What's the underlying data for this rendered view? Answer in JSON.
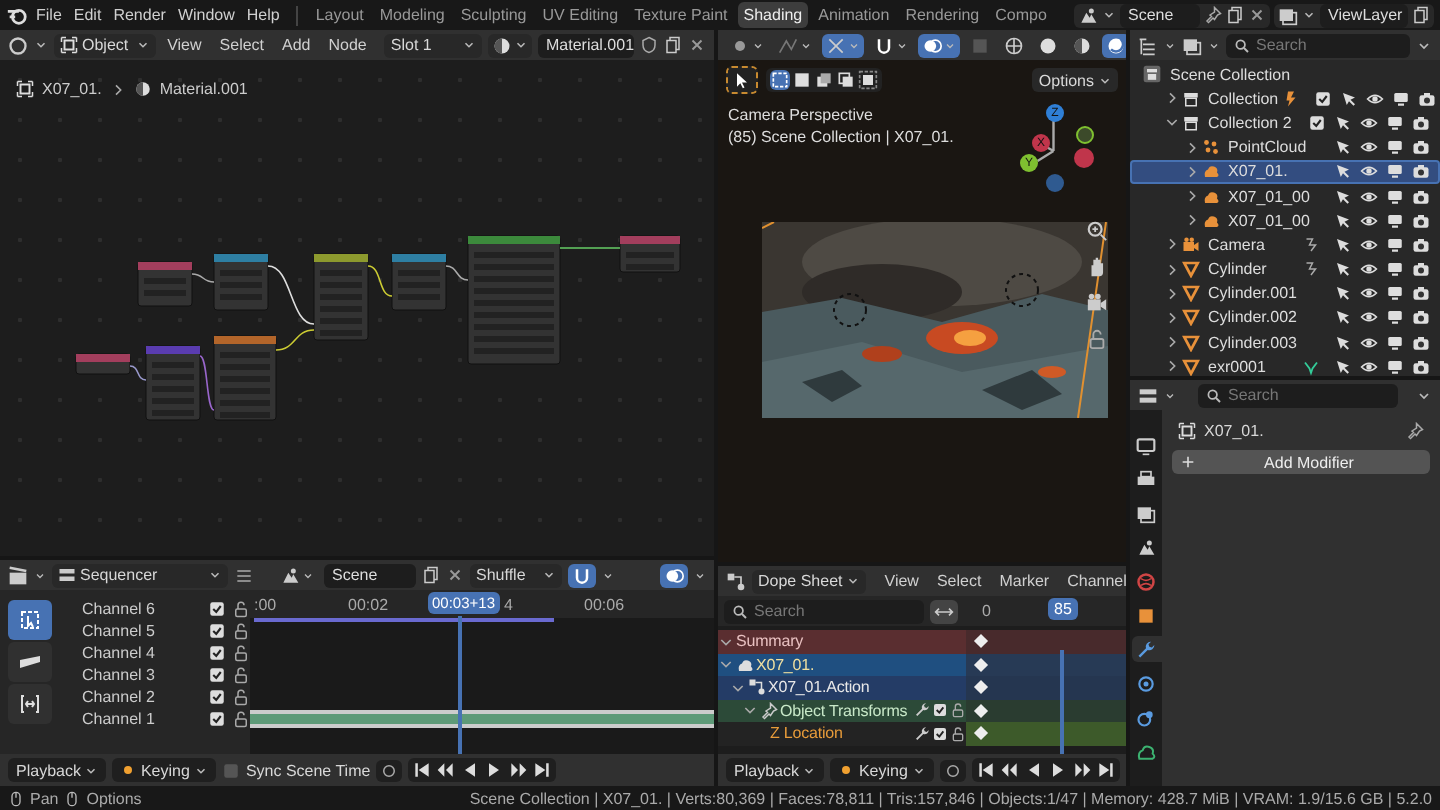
{
  "menu": [
    "File",
    "Edit",
    "Render",
    "Window",
    "Help"
  ],
  "workspaces": [
    {
      "label": "Layout",
      "selected": false
    },
    {
      "label": "Modeling",
      "selected": false
    },
    {
      "label": "Sculpting",
      "selected": false
    },
    {
      "label": "UV Editing",
      "selected": false
    },
    {
      "label": "Texture Paint",
      "selected": false
    },
    {
      "label": "Shading",
      "selected": true
    },
    {
      "label": "Animation",
      "selected": false
    },
    {
      "label": "Rendering",
      "selected": false
    },
    {
      "label": "Compo",
      "selected": false
    }
  ],
  "scene": "Scene",
  "view_layer": "ViewLayer",
  "node_editor": {
    "mode": "Object",
    "menus": [
      "View",
      "Select",
      "Add",
      "Node"
    ],
    "slot": "Slot 1",
    "material": "Material.001",
    "breadcrumb": [
      "X07_01.",
      "Material.001"
    ]
  },
  "viewport": {
    "options": "Options",
    "title": "Camera Perspective",
    "subtitle": "(85) Scene Collection | X07_01.",
    "gizmo": [
      "Z",
      "X",
      "Y"
    ]
  },
  "outliner": {
    "search_placeholder": "Search",
    "root": "Scene Collection",
    "items": [
      {
        "name": "Collection",
        "kind": "collection",
        "badge": {
          "kind": "light"
        },
        "checked": true,
        "expanded": false,
        "selected": false
      },
      {
        "name": "Collection 2",
        "kind": "collection",
        "checked": true,
        "expanded": true,
        "selected": false,
        "children": [
          {
            "name": "PointCloud",
            "kind": "pointcloud",
            "expanded": false,
            "selected": false
          },
          {
            "name": "X07_01.",
            "kind": "volume",
            "expanded": false,
            "selected": true
          },
          {
            "name": "X07_01_00",
            "kind": "volume",
            "expanded": false,
            "selected": false
          },
          {
            "name": "X07_01_00",
            "kind": "volume",
            "expanded": false,
            "selected": false
          }
        ]
      },
      {
        "name": "Camera",
        "kind": "camera",
        "badge": {
          "kind": "hook"
        },
        "expanded": false,
        "selected": false
      },
      {
        "name": "Cylinder",
        "kind": "mesh",
        "badge": {
          "kind": "hook"
        },
        "expanded": false,
        "selected": false
      },
      {
        "name": "Cylinder.001",
        "kind": "mesh",
        "expanded": false,
        "selected": false
      },
      {
        "name": "Cylinder.002",
        "kind": "mesh",
        "expanded": false,
        "selected": false
      },
      {
        "name": "Cylinder.003",
        "kind": "mesh",
        "expanded": false,
        "selected": false
      },
      {
        "name": "exr0001",
        "kind": "mesh",
        "badge": {
          "kind": "shader"
        },
        "expanded": false,
        "selected": false
      }
    ]
  },
  "properties": {
    "search_placeholder": "Search",
    "object": "X07_01.",
    "add_modifier": "Add Modifier",
    "tabs": [
      {
        "kind": "render",
        "selected": false
      },
      {
        "kind": "output",
        "selected": false
      },
      {
        "kind": "view_layer",
        "selected": false
      },
      {
        "kind": "scene",
        "selected": false
      },
      {
        "kind": "world",
        "selected": false
      },
      {
        "kind": "object",
        "selected": false
      },
      {
        "kind": "modifiers",
        "selected": true
      },
      {
        "kind": "particles",
        "selected": false
      },
      {
        "kind": "physics",
        "selected": false
      },
      {
        "kind": "data",
        "selected": false
      }
    ]
  },
  "sequencer": {
    "editor": "Sequencer",
    "scene": "Scene",
    "snap": "Shuffle",
    "timecode": "00:03+13",
    "ticks": [
      ":00",
      "00:02",
      "4",
      "00:06"
    ],
    "channels": [
      {
        "name": "Channel 6",
        "checked": true,
        "locked": false
      },
      {
        "name": "Channel 5",
        "checked": true,
        "locked": false
      },
      {
        "name": "Channel 4",
        "checked": true,
        "locked": false
      },
      {
        "name": "Channel 3",
        "checked": true,
        "locked": false
      },
      {
        "name": "Channel 2",
        "checked": true,
        "locked": false
      },
      {
        "name": "Channel 1",
        "checked": true,
        "locked": false
      }
    ],
    "playback": {
      "menus": [
        "Playback",
        "Keying"
      ],
      "sync_label": "Sync Scene Time",
      "sync": false
    }
  },
  "dope_sheet": {
    "editor": "Dope Sheet",
    "menus": [
      "View",
      "Select",
      "Marker",
      "Channel"
    ],
    "search_placeholder": "Search",
    "tick": "0",
    "frame": "85",
    "channels": [
      {
        "kind": "summary",
        "name": "Summary",
        "expanded": true
      },
      {
        "kind": "object",
        "name": "X07_01.",
        "expanded": true
      },
      {
        "kind": "action",
        "name": "X07_01.Action",
        "expanded": true
      },
      {
        "kind": "group",
        "name": "Object Transforms",
        "expanded": true
      },
      {
        "kind": "fcurve",
        "name": "Z Location"
      }
    ],
    "playback": {
      "menus": [
        "Playback",
        "Keying"
      ]
    }
  },
  "status": {
    "hints": [
      "Pan",
      "Options"
    ],
    "stats": "Scene Collection | X07_01. | Verts:80,369 | Faces:78,811 | Tris:157,846 | Objects:1/47 | Memory: 428.7 MiB | VRAM: 1.9/15.6 GB | 5.2.0"
  }
}
